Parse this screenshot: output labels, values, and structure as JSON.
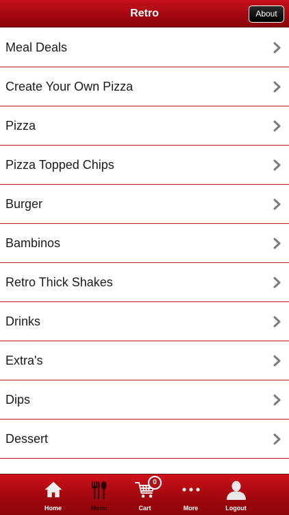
{
  "header": {
    "title": "Retro",
    "about_label": "About"
  },
  "menu": {
    "items": [
      {
        "label": "Meal Deals"
      },
      {
        "label": "Create Your Own Pizza"
      },
      {
        "label": "Pizza"
      },
      {
        "label": "Pizza Topped Chips"
      },
      {
        "label": "Burger"
      },
      {
        "label": "Bambinos"
      },
      {
        "label": "Retro Thick Shakes"
      },
      {
        "label": "Drinks"
      },
      {
        "label": "Extra's"
      },
      {
        "label": "Dips"
      },
      {
        "label": "Dessert"
      }
    ]
  },
  "tabbar": {
    "tabs": [
      {
        "label": "Home",
        "icon": "home-icon"
      },
      {
        "label": "Menu",
        "icon": "cutlery-icon",
        "active": true
      },
      {
        "label": "Cart",
        "icon": "cart-icon"
      },
      {
        "label": "More",
        "icon": "more-icon"
      },
      {
        "label": "Logout",
        "icon": "user-icon"
      }
    ],
    "cart_count": "0"
  },
  "colors": {
    "brand_red": "#a40811",
    "divider_red": "#c1121c",
    "chevron_gray": "#7a7a7a"
  }
}
